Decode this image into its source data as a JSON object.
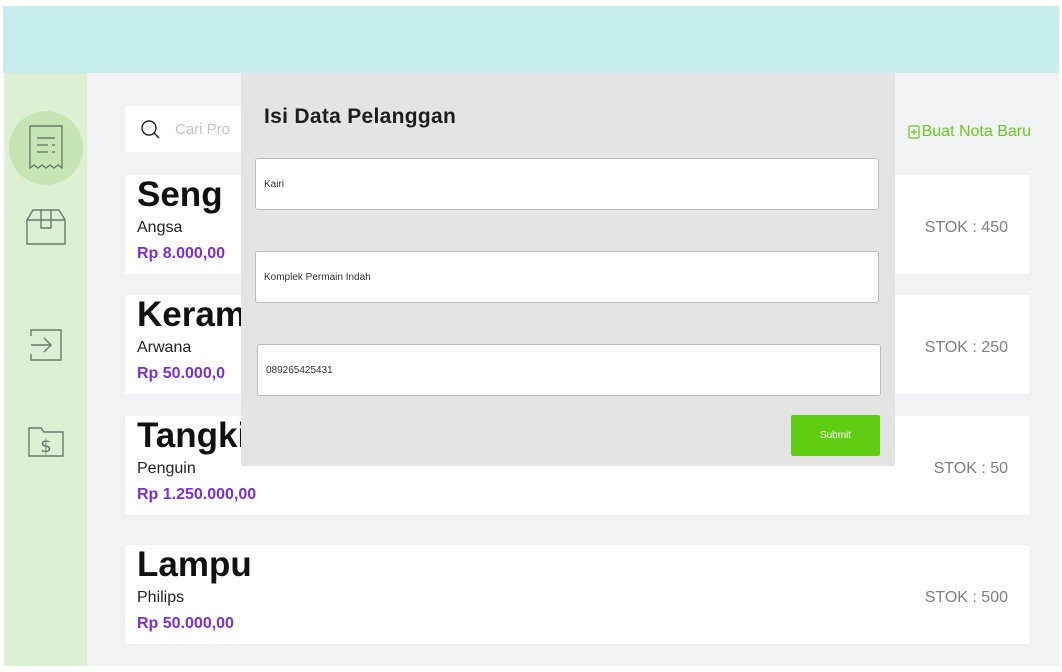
{
  "search": {
    "placeholder": "Cari Pro"
  },
  "actions": {
    "new_note_label": "Buat Nota Baru"
  },
  "sidebar": {
    "items": [
      {
        "icon": "receipt-icon",
        "active": true
      },
      {
        "icon": "box-icon",
        "active": false
      },
      {
        "icon": "logout-icon",
        "active": false
      },
      {
        "icon": "money-folder-icon",
        "active": false
      }
    ]
  },
  "products": [
    {
      "name": "Seng",
      "brand": "Angsa",
      "price": "Rp 8.000,00",
      "stock": "STOK : 450"
    },
    {
      "name": "Keram",
      "brand": "Arwana",
      "price": "Rp 50.000,0",
      "stock": "STOK : 250"
    },
    {
      "name": "Tangki",
      "brand": "Penguin",
      "price": "Rp 1.250.000,00",
      "stock": "STOK : 50"
    },
    {
      "name": "Lampu",
      "brand": "Philips",
      "price": "Rp 50.000,00",
      "stock": "STOK : 500"
    }
  ],
  "modal": {
    "title": "Isi Data Pelanggan",
    "fields": {
      "name": "Kairi",
      "address": "Komplek Permain Indah",
      "phone": "089265425431"
    },
    "submit_label": "Submit"
  },
  "colors": {
    "topbar": "#c6eeec",
    "sidebar": "#ddf0d3",
    "accent_green": "#5fcd12",
    "price_purple": "#7a2fe0"
  }
}
